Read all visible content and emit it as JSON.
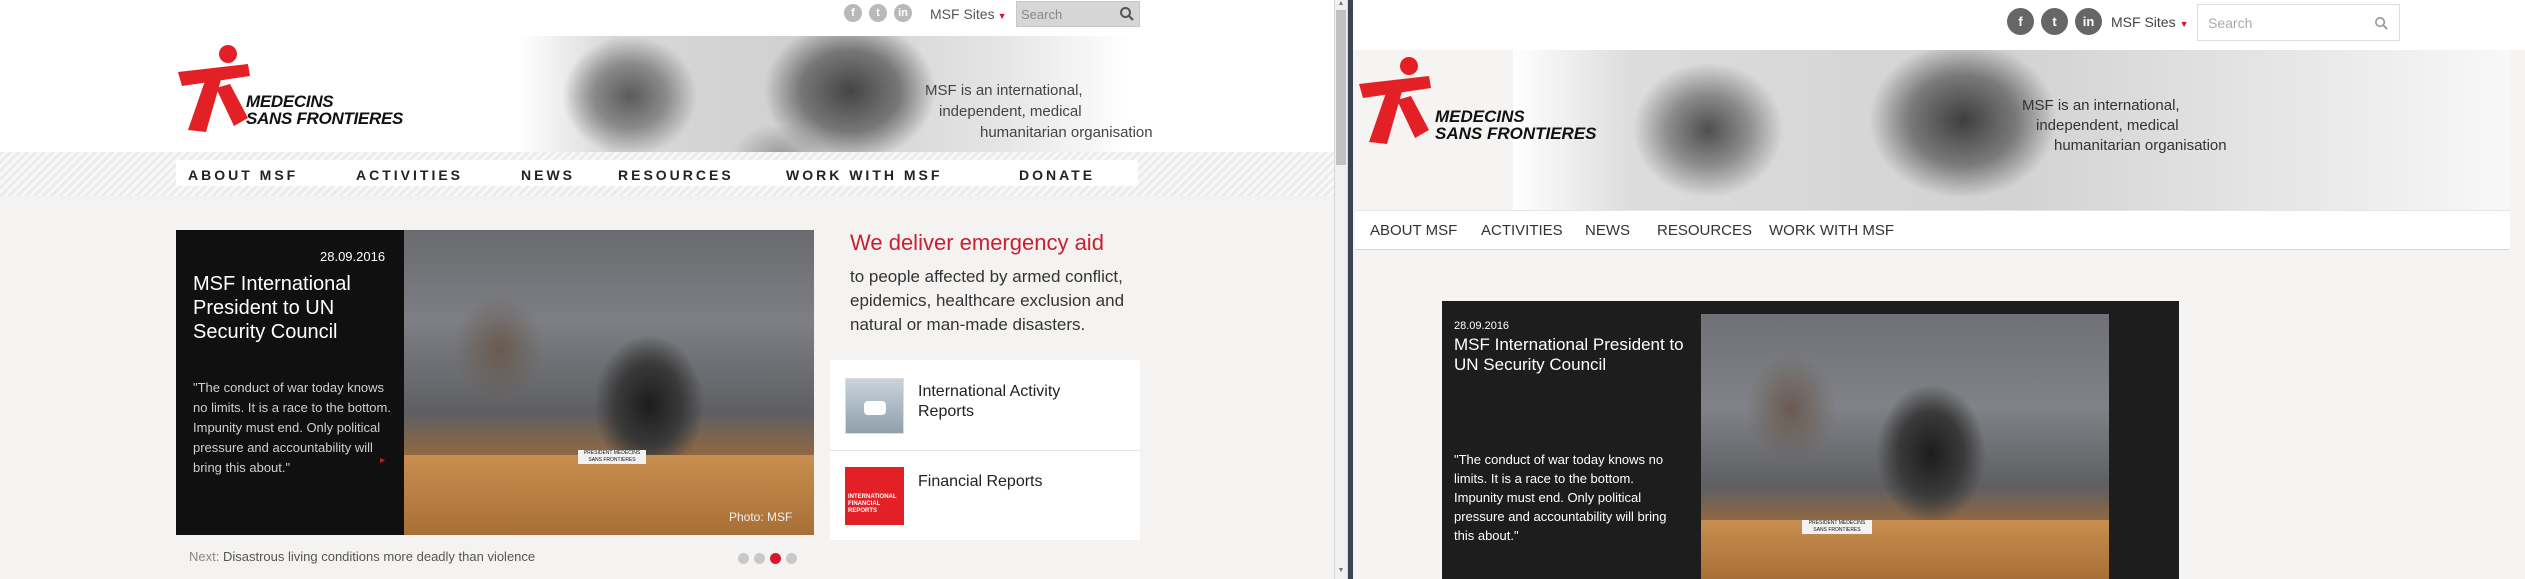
{
  "left": {
    "social": [
      "f",
      "t",
      "in"
    ],
    "msf_sites": "MSF Sites",
    "search_placeholder": "Search",
    "logo": {
      "line1": "MEDECINS",
      "line2": "SANS FRONTIERES"
    },
    "tagline": [
      "MSF is an international,",
      "independent, medical",
      "humanitarian organisation"
    ],
    "nav": [
      "ABOUT MSF",
      "ACTIVITIES",
      "NEWS",
      "RESOURCES",
      "WORK WITH MSF",
      "DONATE"
    ],
    "feature": {
      "date": "28.09.2016",
      "title": "MSF International President to UN Security Council",
      "quote": "\"The conduct of war today knows no limits. It is a race to the bottom. Impunity must end. Only political pressure and accountability will bring this about.\"",
      "credit": "Photo: MSF",
      "placard": "PRESIDENT MEDECINS SANS FRONTIERES"
    },
    "next": {
      "label": "Next:",
      "text": "Disastrous living conditions more deadly than violence"
    },
    "slider_dots": {
      "count": 4,
      "active": 3
    },
    "emergency": {
      "title": "We deliver emergency aid",
      "text": "to people affected by armed conflict, epidemics, healthcare exclusion and natural or man-made disasters."
    },
    "cards": [
      {
        "title": "International Activity Reports"
      },
      {
        "title": "Financial Reports",
        "thumb_text": "INTERNATIONAL FINANCIAL REPORTS"
      }
    ]
  },
  "right": {
    "social": [
      "f",
      "t",
      "in"
    ],
    "msf_sites": "MSF Sites",
    "search_placeholder": "Search",
    "logo": {
      "line1": "MEDECINS",
      "line2": "SANS FRONTIERES"
    },
    "tagline": [
      "MSF is an international,",
      "independent, medical",
      "humanitarian organisation"
    ],
    "nav": [
      "ABOUT MSF",
      "ACTIVITIES",
      "NEWS",
      "RESOURCES",
      "WORK WITH MSF"
    ],
    "feature": {
      "date": "28.09.2016",
      "title": "MSF International President to UN Security Council",
      "quote": "\"The conduct of war today knows no limits. It is a race to the bottom. Impunity must end. Only political pressure and accountability will bring this about.\"",
      "placard": "PRESIDENT MEDECINS SANS FRONTIERES"
    }
  },
  "colors": {
    "brand_red": "#d2192d",
    "page_bg": "#f3f2f0",
    "feature_bg": "#101010"
  }
}
